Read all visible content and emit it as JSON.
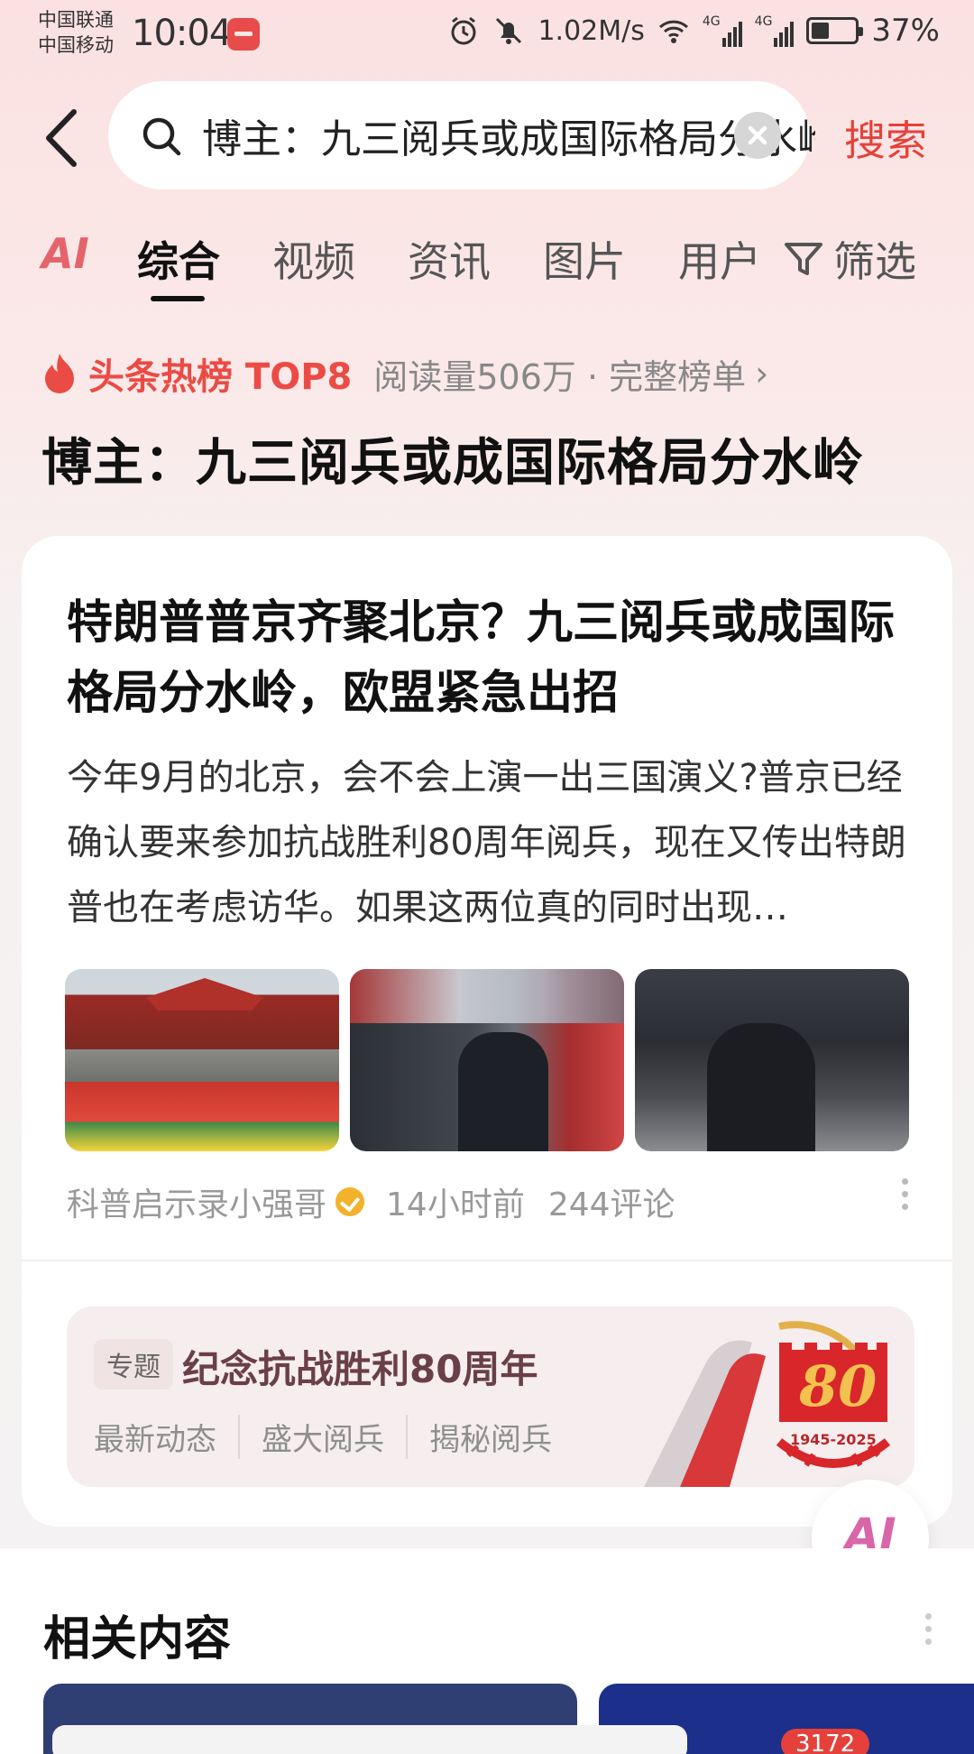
{
  "status_bar": {
    "carrier_1": "中国联通",
    "carrier_2": "中国移动",
    "time": "10:04",
    "speed": "1.02M/s",
    "net_1": "4G",
    "net_2": "4G",
    "battery": "37%",
    "battery_level": 0.37
  },
  "search": {
    "query": "博主：九三阅兵或成国际格局分水岭",
    "submit_label": "搜索"
  },
  "tabs": {
    "ai": "AI",
    "items": [
      "综合",
      "视频",
      "资讯",
      "图片",
      "用户"
    ],
    "active_index": 0,
    "filter": "筛选"
  },
  "hot": {
    "label": "头条热榜 TOP8",
    "meta": "阅读量506万 · 完整榜单",
    "chevron": "›",
    "topic_title": "博主：九三阅兵或成国际格局分水岭"
  },
  "article": {
    "title": "特朗普普京齐聚北京？九三阅兵或成国际格局分水岭，欧盟紧急出招",
    "summary": "今年9月的北京，会不会上演一出三国演义?普京已经确认要来参加抗战胜利80周年阅兵，现在又传出特朗普也在考虑访华。如果这两位真的同时出现…",
    "author": "科普启示录小强哥",
    "time": "14小时前",
    "comments": "244评论"
  },
  "special": {
    "tag": "专题",
    "title": "纪念抗战胜利80周年",
    "links": [
      "最新动态",
      "盛大阅兵",
      "揭秘阅兵"
    ],
    "emblem_number": "80",
    "emblem_years": "1945-2025"
  },
  "fab": {
    "label": "AI"
  },
  "related": {
    "title": "相关内容",
    "badge": "3172"
  },
  "colors": {
    "accent": "#e5413a",
    "background_top": "#fbe1e1",
    "card": "#ffffff"
  }
}
